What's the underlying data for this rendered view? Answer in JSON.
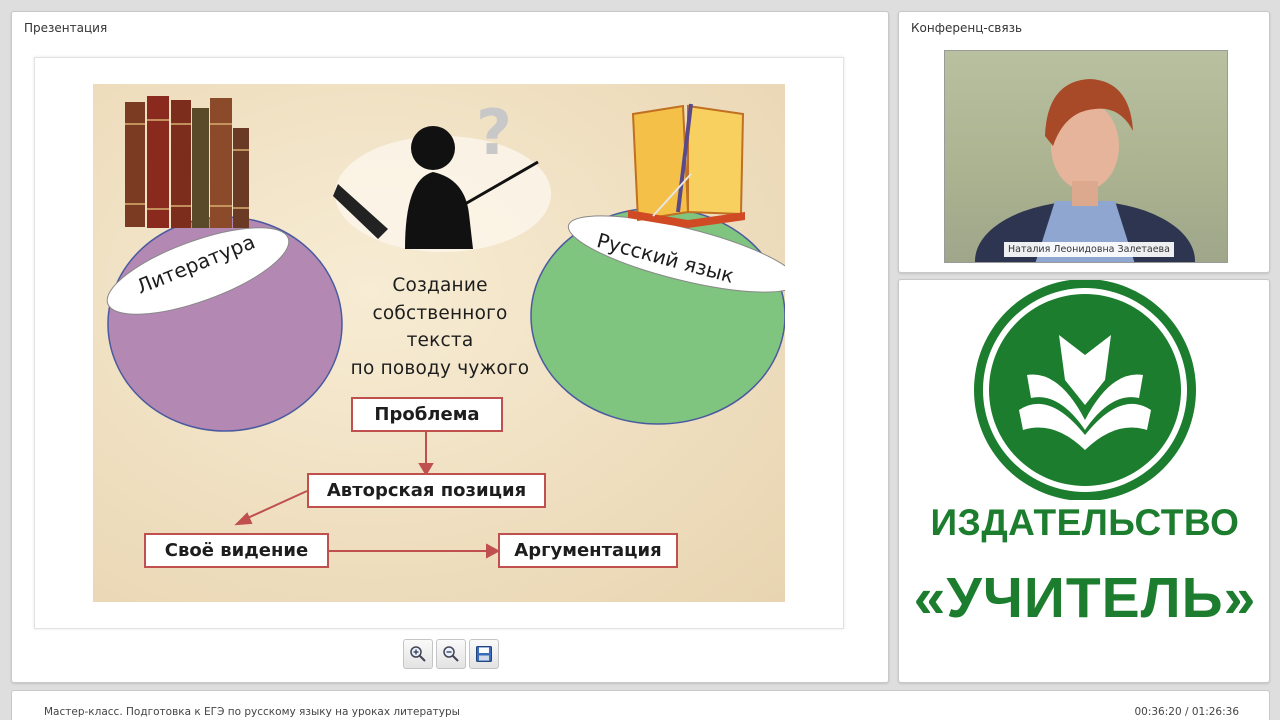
{
  "presentation_panel": {
    "title": "Презентация"
  },
  "conference_panel": {
    "title": "Конференц-связь",
    "speaker_name": "Наталия Леонидовна Залетаева"
  },
  "slide": {
    "left_ellipse_label": "Литература",
    "right_ellipse_label": "Русский язык",
    "center_title_lines": [
      "Создание",
      "собственного",
      "текста",
      "по поводу чужого"
    ],
    "boxes": {
      "problem": "Проблема",
      "author_position": "Авторская позиция",
      "own_vision": "Своё видение",
      "argumentation": "Аргументация"
    },
    "colors": {
      "accent_red": "#c0504d",
      "left_circle": "#b389b3",
      "right_circle": "#7fc47f"
    }
  },
  "toolbar": {
    "zoom_in_icon": "zoom-in-icon",
    "zoom_out_icon": "zoom-out-icon",
    "save_icon": "save-icon"
  },
  "logo": {
    "line1": "ИЗДАТЕЛЬСТВО",
    "line2": "«УЧИТЕЛЬ»",
    "color": "#1c7d2e"
  },
  "footer": {
    "title": "Мастер-класс. Подготовка к ЕГЭ по русскому языку на уроках литературы",
    "time": "00:36:20 / 01:26:36"
  }
}
